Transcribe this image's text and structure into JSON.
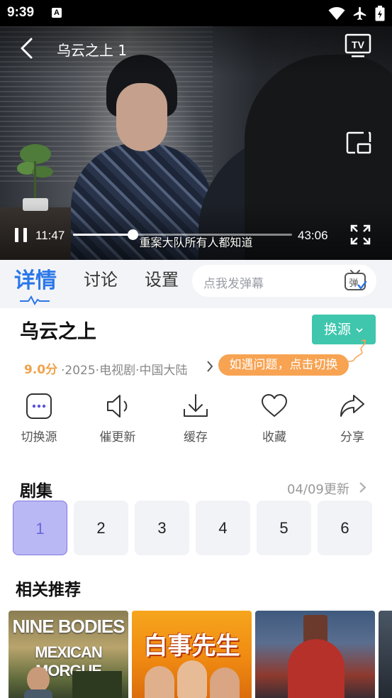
{
  "status_bar": {
    "time": "9:39",
    "notification_badge": "A",
    "icons": [
      "wifi-icon",
      "airplane-mode-icon",
      "battery-icon"
    ]
  },
  "player": {
    "title": "乌云之上 1",
    "current_time": "11:47",
    "total_time": "43:06",
    "progress_fraction": 0.273,
    "subtitle": "重案大队所有人都知道",
    "state": "playing"
  },
  "tabs": {
    "items": [
      "详情",
      "讨论",
      "设置"
    ],
    "active_index": 0,
    "danmaku_placeholder": "点我发弹幕",
    "danmaku_badge": "弹"
  },
  "show": {
    "title": "乌云之上",
    "source_button": "换源",
    "rating": "9.0分",
    "meta": "·2025·电视剧·中国大陆",
    "tip": "如遇问题，点击切换"
  },
  "actions": [
    {
      "label": "切换源",
      "icon": "switch-source-icon"
    },
    {
      "label": "催更新",
      "icon": "speaker-icon"
    },
    {
      "label": "缓存",
      "icon": "download-icon"
    },
    {
      "label": "收藏",
      "icon": "heart-icon"
    },
    {
      "label": "分享",
      "icon": "share-icon"
    }
  ],
  "episodes": {
    "title": "剧集",
    "update_info": "04/09更新",
    "items": [
      "1",
      "2",
      "3",
      "4",
      "5",
      "6"
    ],
    "active_index": 0
  },
  "recommend": {
    "title": "相关推荐",
    "posters": [
      {
        "line1": "NINE BODIES",
        "line2": "MEXICAN MORGUE"
      },
      {
        "line1": "白事先生"
      },
      {},
      {}
    ]
  },
  "colors": {
    "accent_blue": "#2b77e8",
    "source_green": "#3fc6ad",
    "tip_orange": "#f7a352",
    "rating_orange": "#f0a24b",
    "episode_active": "#b9b8f5"
  }
}
